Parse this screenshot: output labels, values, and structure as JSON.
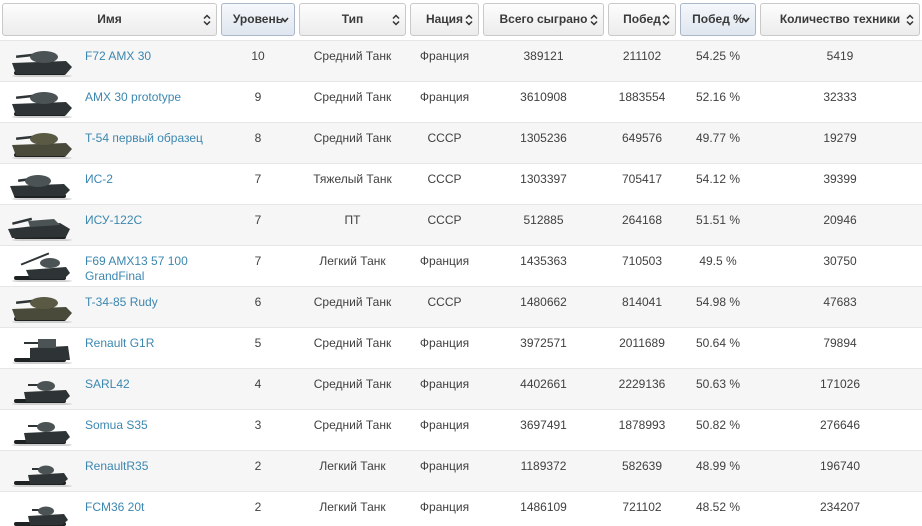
{
  "columns": [
    {
      "id": "name",
      "label": "Имя",
      "sort": "both",
      "active": false
    },
    {
      "id": "level",
      "label": "Уровень",
      "sort": "desc",
      "active": true
    },
    {
      "id": "type",
      "label": "Тип",
      "sort": "both",
      "active": false
    },
    {
      "id": "nation",
      "label": "Нация",
      "sort": "both",
      "active": false
    },
    {
      "id": "battles",
      "label": "Всего сыграно",
      "sort": "both",
      "active": false
    },
    {
      "id": "wins",
      "label": "Побед",
      "sort": "both",
      "active": false
    },
    {
      "id": "winrate",
      "label": "Побед %",
      "sort": "desc",
      "active": true
    },
    {
      "id": "count",
      "label": "Количество техники",
      "sort": "both",
      "active": false
    }
  ],
  "rows": [
    {
      "name": "F72 AMX 30",
      "level": "10",
      "type": "Средний Танк",
      "nation": "Франция",
      "battles": "389121",
      "wins": "211102",
      "winrate": "54.25 %",
      "count": "5419",
      "thumb": "medium"
    },
    {
      "name": "AMX 30 prototype",
      "level": "9",
      "type": "Средний Танк",
      "nation": "Франция",
      "battles": "3610908",
      "wins": "1883554",
      "winrate": "52.16 %",
      "count": "32333",
      "thumb": "medium"
    },
    {
      "name": "T-54 первый образец",
      "level": "8",
      "type": "Средний Танк",
      "nation": "СССР",
      "battles": "1305236",
      "wins": "649576",
      "winrate": "49.77 %",
      "count": "19279",
      "thumb": "camo"
    },
    {
      "name": "ИС-2",
      "level": "7",
      "type": "Тяжелый Танк",
      "nation": "СССР",
      "battles": "1303397",
      "wins": "705417",
      "winrate": "54.12 %",
      "count": "39399",
      "thumb": "heavy"
    },
    {
      "name": "ИСУ-122С",
      "level": "7",
      "type": "ПТ",
      "nation": "СССР",
      "battles": "512885",
      "wins": "264168",
      "winrate": "51.51 %",
      "count": "20946",
      "thumb": "td"
    },
    {
      "name": "F69 AMX13 57 100 GrandFinal",
      "level": "7",
      "type": "Легкий Танк",
      "nation": "Франция",
      "battles": "1435363",
      "wins": "710503",
      "winrate": "49.5 %",
      "count": "30750",
      "thumb": "light"
    },
    {
      "name": "T-34-85 Rudy",
      "level": "6",
      "type": "Средний Танк",
      "nation": "СССР",
      "battles": "1480662",
      "wins": "814041",
      "winrate": "54.98 %",
      "count": "47683",
      "thumb": "camo"
    },
    {
      "name": "Renault G1R",
      "level": "5",
      "type": "Средний Танк",
      "nation": "Франция",
      "battles": "3972571",
      "wins": "2011689",
      "winrate": "50.64 %",
      "count": "79894",
      "thumb": "box"
    },
    {
      "name": "SARL42",
      "level": "4",
      "type": "Средний Танк",
      "nation": "Франция",
      "battles": "4402661",
      "wins": "2229136",
      "winrate": "50.63 %",
      "count": "171026",
      "thumb": "small"
    },
    {
      "name": "Somua S35",
      "level": "3",
      "type": "Средний Танк",
      "nation": "Франция",
      "battles": "3697491",
      "wins": "1878993",
      "winrate": "50.82 %",
      "count": "276646",
      "thumb": "small"
    },
    {
      "name": "RenaultR35",
      "level": "2",
      "type": "Легкий Танк",
      "nation": "Франция",
      "battles": "1189372",
      "wins": "582639",
      "winrate": "48.99 %",
      "count": "196740",
      "thumb": "tiny"
    },
    {
      "name": "FCM36 20t",
      "level": "2",
      "type": "Легкий Танк",
      "nation": "Франция",
      "battles": "1486109",
      "wins": "721102",
      "winrate": "48.52 %",
      "count": "234207",
      "thumb": "tiny"
    }
  ],
  "colors": {
    "link": "#3c87b0",
    "row_odd": "#f6f6f6",
    "row_even": "#ffffff",
    "tank_dark": "#2e3436",
    "tank_mid": "#4b5354",
    "tank_camo": "#4a4a3a"
  }
}
